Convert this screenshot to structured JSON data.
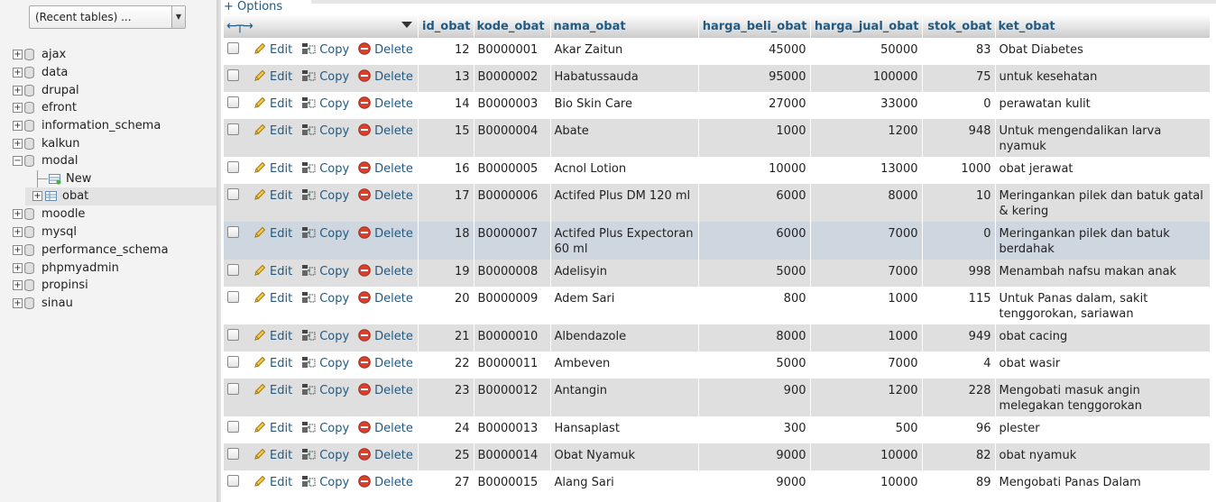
{
  "sidebar": {
    "recent_tables": "(Recent tables) ...",
    "databases": [
      {
        "name": "ajax",
        "expand": "+"
      },
      {
        "name": "data",
        "expand": "+"
      },
      {
        "name": "drupal",
        "expand": "+"
      },
      {
        "name": "efront",
        "expand": "+"
      },
      {
        "name": "information_schema",
        "expand": "+"
      },
      {
        "name": "kalkun",
        "expand": "+"
      },
      {
        "name": "modal",
        "expand": "−"
      },
      {
        "name": "moodle",
        "expand": "+"
      },
      {
        "name": "mysql",
        "expand": "+"
      },
      {
        "name": "performance_schema",
        "expand": "+"
      },
      {
        "name": "phpmyadmin",
        "expand": "+"
      },
      {
        "name": "propinsi",
        "expand": "+"
      },
      {
        "name": "sinau",
        "expand": "+"
      }
    ],
    "modal_children": [
      {
        "name": "New"
      },
      {
        "name": "obat",
        "expand": "+"
      }
    ]
  },
  "main": {
    "options_label": "+ Options",
    "columns": [
      "id_obat",
      "kode_obat",
      "nama_obat",
      "harga_beli_obat",
      "harga_jual_obat",
      "stok_obat",
      "ket_obat"
    ],
    "actions": {
      "edit": "Edit",
      "copy": "Copy",
      "delete": "Delete"
    },
    "rows": [
      {
        "id": "12",
        "kode": "B0000001",
        "nama": "Akar Zaitun",
        "beli": "45000",
        "jual": "50000",
        "stok": "83",
        "ket": "Obat Diabetes"
      },
      {
        "id": "13",
        "kode": "B0000002",
        "nama": "Habatussauda",
        "beli": "95000",
        "jual": "100000",
        "stok": "75",
        "ket": "untuk kesehatan"
      },
      {
        "id": "14",
        "kode": "B0000003",
        "nama": "Bio Skin Care",
        "beli": "27000",
        "jual": "33000",
        "stok": "0",
        "ket": "perawatan kulit"
      },
      {
        "id": "15",
        "kode": "B0000004",
        "nama": "Abate",
        "beli": "1000",
        "jual": "1200",
        "stok": "948",
        "ket": "Untuk mengendalikan larva nyamuk"
      },
      {
        "id": "16",
        "kode": "B0000005",
        "nama": "Acnol Lotion",
        "beli": "10000",
        "jual": "13000",
        "stok": "1000",
        "ket": "obat jerawat"
      },
      {
        "id": "17",
        "kode": "B0000006",
        "nama": "Actifed Plus DM 120 ml",
        "beli": "6000",
        "jual": "8000",
        "stok": "10",
        "ket": "Meringankan pilek dan batuk gatal & kering"
      },
      {
        "id": "18",
        "kode": "B0000007",
        "nama": "Actifed Plus Expectoran 60 ml",
        "beli": "6000",
        "jual": "7000",
        "stok": "0",
        "ket": "Meringankan pilek dan batuk berdahak"
      },
      {
        "id": "19",
        "kode": "B0000008",
        "nama": "Adelisyin",
        "beli": "5000",
        "jual": "7000",
        "stok": "998",
        "ket": "Menambah nafsu makan anak"
      },
      {
        "id": "20",
        "kode": "B0000009",
        "nama": "Adem Sari",
        "beli": "800",
        "jual": "1000",
        "stok": "115",
        "ket": "Untuk Panas dalam, sakit tenggorokan, sariawan"
      },
      {
        "id": "21",
        "kode": "B0000010",
        "nama": "Albendazole",
        "beli": "8000",
        "jual": "1000",
        "stok": "949",
        "ket": "obat cacing"
      },
      {
        "id": "22",
        "kode": "B0000011",
        "nama": "Ambeven",
        "beli": "5000",
        "jual": "7000",
        "stok": "4",
        "ket": "obat wasir"
      },
      {
        "id": "23",
        "kode": "B0000012",
        "nama": "Antangin",
        "beli": "900",
        "jual": "1200",
        "stok": "228",
        "ket": "Mengobati masuk angin melegakan tenggorokan"
      },
      {
        "id": "24",
        "kode": "B0000013",
        "nama": "Hansaplast",
        "beli": "300",
        "jual": "500",
        "stok": "96",
        "ket": "plester"
      },
      {
        "id": "25",
        "kode": "B0000014",
        "nama": "Obat Nyamuk",
        "beli": "9000",
        "jual": "10000",
        "stok": "82",
        "ket": "obat nyamuk"
      },
      {
        "id": "27",
        "kode": "B0000015",
        "nama": "Alang Sari",
        "beli": "9000",
        "jual": "10000",
        "stok": "89",
        "ket": "Mengobati Panas Dalam"
      }
    ],
    "highlighted_row": 6
  },
  "colors": {
    "link": "#235a81",
    "row_even": "#dfdfdf",
    "row_highlight": "#ced6df",
    "delete_icon": "#d9412f"
  },
  "icons": {
    "edit": "pencil-icon",
    "copy": "copy-icon",
    "delete": "delete-icon",
    "database": "database-icon",
    "table": "table-icon",
    "new": "new-table-icon"
  }
}
